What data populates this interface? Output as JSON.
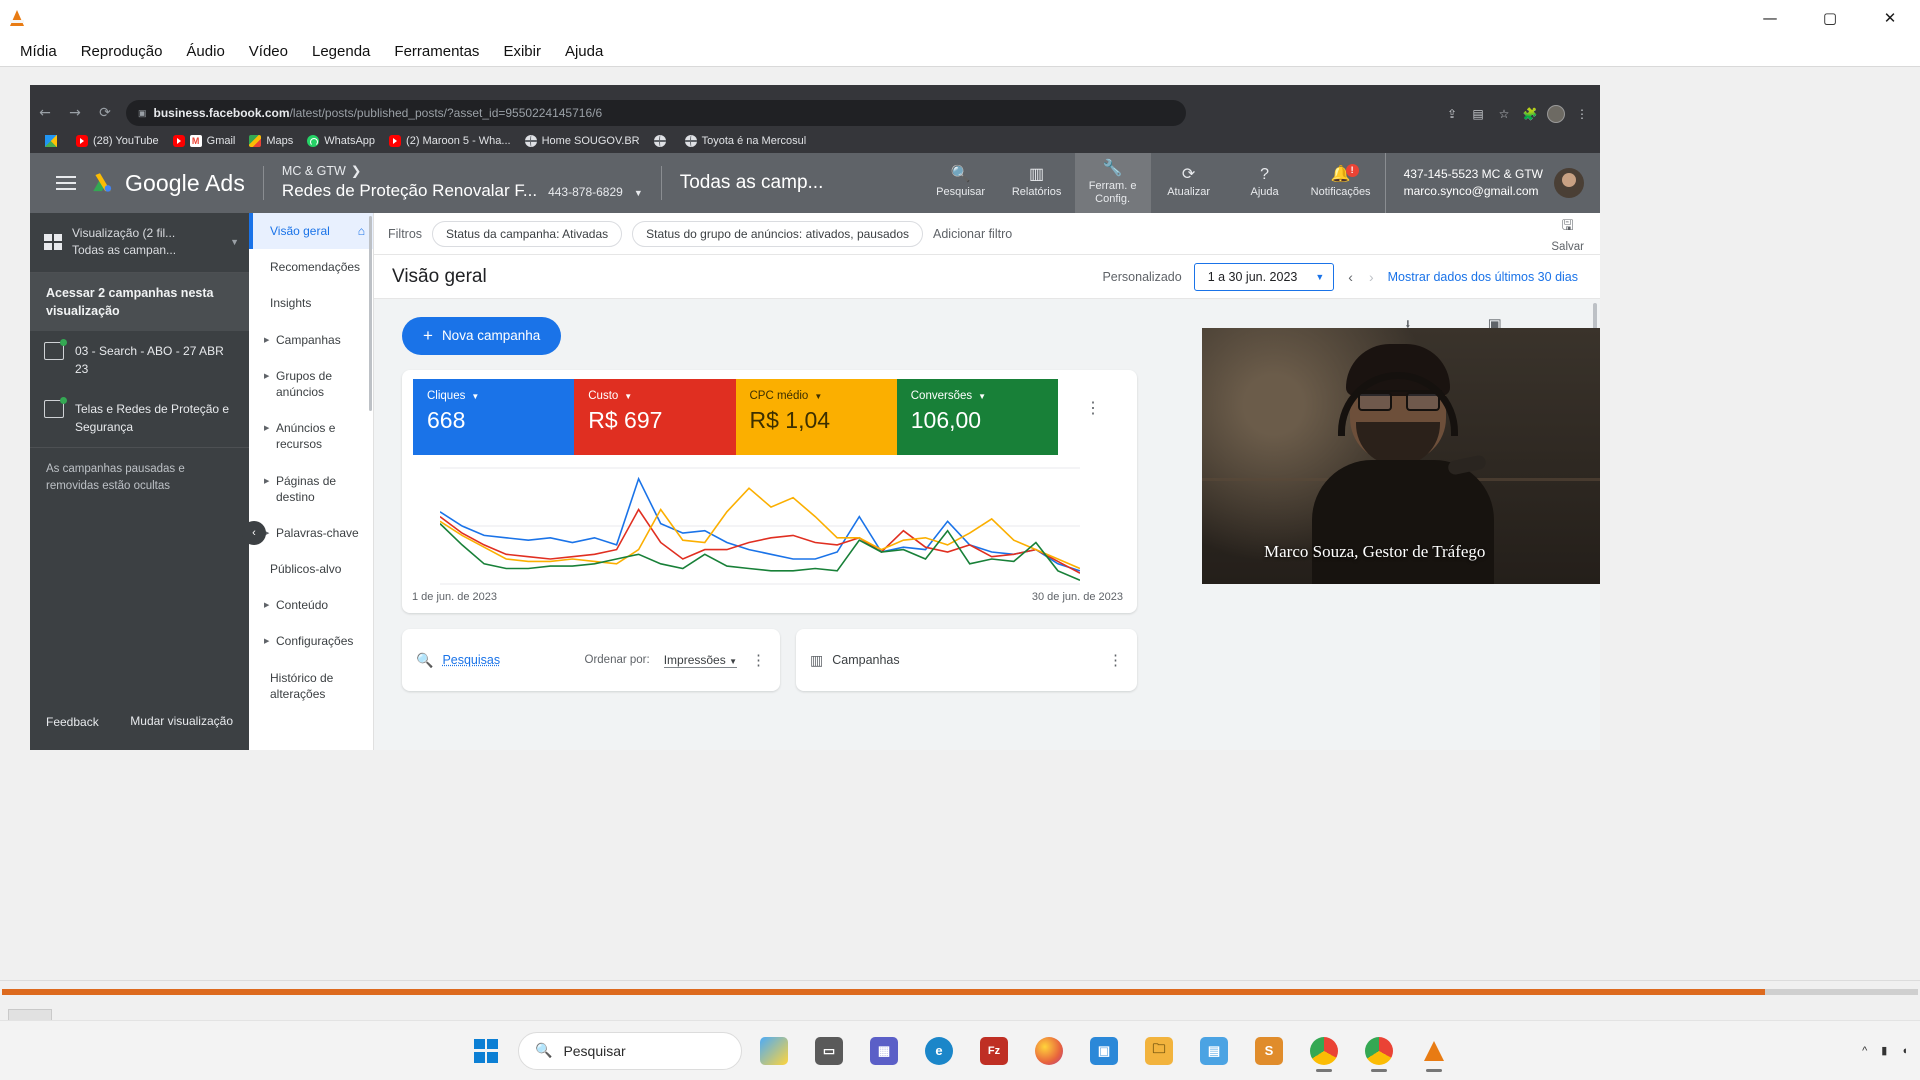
{
  "vlc": {
    "app_icon": "vlc-cone-icon",
    "menu": [
      "Mídia",
      "Reprodução",
      "Áudio",
      "Vídeo",
      "Legenda",
      "Ferramentas",
      "Exibir",
      "Ajuda"
    ],
    "window_controls": {
      "minimize": "—",
      "maximize": "▢",
      "close": "✕"
    },
    "controls": {
      "play": "▶",
      "previous": "⏮",
      "stop": "⏹",
      "next": "⏭",
      "fullscreen": "⛶",
      "equalizer": "equalizer-icon",
      "playlist": "playlist-icon",
      "loop": "🔁",
      "shuffle": "🔀"
    }
  },
  "browser": {
    "back": "←",
    "forward": "→",
    "reload": "⟳",
    "lock_icon": "page-info-icon",
    "url_domain": "business.facebook.com",
    "url_path": "/latest/posts/published_posts/?asset_id=9550224145716/6",
    "bookmarks": [
      {
        "label": "",
        "icon": "drive-icon"
      },
      {
        "label": "(28) YouTube",
        "icon": "youtube-icon"
      },
      {
        "label": "Gmail",
        "icon": "gmail-icon"
      },
      {
        "label": "Maps",
        "icon": "maps-icon"
      },
      {
        "label": "WhatsApp",
        "icon": "whatsapp-icon"
      },
      {
        "label": "(2) Maroon 5 - Wha...",
        "icon": "youtube-icon"
      },
      {
        "label": "Home SOUGOV.BR",
        "icon": "globe-icon"
      },
      {
        "label": "",
        "icon": "globe-icon"
      },
      {
        "label": "Toyota é na Mercosul",
        "icon": "globe-icon"
      }
    ]
  },
  "gads": {
    "logo_text": "Google Ads",
    "account": {
      "parent": "MC & GTW",
      "name": "Redes de Proteção Renovalar F...",
      "id": "443-878-6829"
    },
    "scope": "Todas as camp...",
    "actions": [
      {
        "label": "Pesquisar",
        "icon": "search-icon",
        "glyph": "🔍"
      },
      {
        "label": "Relatórios",
        "icon": "reports-icon",
        "glyph": "▥"
      },
      {
        "label": "Ferram. e Config.",
        "icon": "wrench-icon",
        "glyph": "🔧"
      },
      {
        "label": "Atualizar",
        "icon": "refresh-icon",
        "glyph": "⟳"
      },
      {
        "label": "Ajuda",
        "icon": "help-icon",
        "glyph": "?"
      },
      {
        "label": "Notificações",
        "icon": "bell-icon",
        "glyph": "🔔"
      }
    ],
    "notification_badge": "!",
    "user": {
      "line1": "437-145-5523 MC & GTW",
      "line2": "marco.synco@gmail.com"
    },
    "views_sidebar": {
      "title_line1": "Visualização (2 fil...",
      "title_line2": "Todas as campan...",
      "access": "Acessar 2 campanhas nesta visualização",
      "campaigns": [
        {
          "label": "03 - Search - ABO - 27 ABR 23",
          "icon": "search-campaign-icon"
        },
        {
          "label": "Telas e Redes de Proteção e Segurança",
          "icon": "display-campaign-icon"
        }
      ],
      "note": "As campanhas pausadas e removidas estão ocultas",
      "footer_feedback": "Feedback",
      "footer_change_view": "Mudar visualização"
    },
    "nav": [
      {
        "label": "Visão geral",
        "expandable": false,
        "selected": true,
        "trailing_icon": "home-icon"
      },
      {
        "label": "Recomendações",
        "expandable": false,
        "selected": false
      },
      {
        "label": "Insights",
        "expandable": false,
        "selected": false
      },
      {
        "label": "Campanhas",
        "expandable": true,
        "selected": false
      },
      {
        "label": "Grupos de anúncios",
        "expandable": true,
        "selected": false
      },
      {
        "label": "Anúncios e recursos",
        "expandable": true,
        "selected": false
      },
      {
        "label": "Páginas de destino",
        "expandable": true,
        "selected": false
      },
      {
        "label": "Palavras-chave",
        "expandable": true,
        "selected": false
      },
      {
        "label": "Públicos-alvo",
        "expandable": false,
        "selected": false
      },
      {
        "label": "Conteúdo",
        "expandable": true,
        "selected": false
      },
      {
        "label": "Configurações",
        "expandable": true,
        "selected": false
      },
      {
        "label": "Histórico de alterações",
        "expandable": false,
        "selected": false
      }
    ],
    "collapse_handle": "‹",
    "filters": {
      "label": "Filtros",
      "chips": [
        "Status da campanha: Ativadas",
        "Status do grupo de anúncios: ativados, pausados"
      ],
      "add": "Adicionar filtro",
      "save": "Salvar",
      "save_icon": "save-icon"
    },
    "page_title": "Visão geral",
    "date": {
      "preset_label": "Personalizado",
      "range": "1 a 30 jun. 2023",
      "prev": "‹",
      "next": "›",
      "last30": "Mostrar dados dos últimos 30 dias"
    },
    "new_campaign": "Nova campanha",
    "download": {
      "label": "Download",
      "icon": "download-icon",
      "glyph": "⭳"
    },
    "feedback": {
      "label": "Feedback",
      "icon": "feedback-icon",
      "glyph": "▣"
    },
    "card_menu": "⋮",
    "scorecards": [
      {
        "label": "Cliques",
        "value": "668",
        "color": "#1a73e8",
        "text": "#ffffff"
      },
      {
        "label": "Custo",
        "value": "R$ 697",
        "color": "#e02f21",
        "text": "#ffffff"
      },
      {
        "label": "CPC médio",
        "value": "R$ 1,04",
        "color": "#fbaf00",
        "text": "#3c2f00"
      },
      {
        "label": "Conversões",
        "value": "106,00",
        "color": "#188038",
        "text": "#ffffff"
      }
    ],
    "chart_start_date": "1 de jun. de 2023",
    "chart_end_date": "30 de jun. de 2023",
    "panels": [
      {
        "title": "Pesquisas",
        "icon": "search-icon",
        "sort_label": "Ordenar por:",
        "sort_value": "Impressões",
        "menu": "⋮"
      },
      {
        "title": "Campanhas",
        "icon": "bar-chart-icon",
        "menu": "⋮"
      }
    ]
  },
  "webcam": {
    "caption": "Marco Souza, Gestor de Tráfego"
  },
  "taskbar": {
    "start_icon": "windows-logo-icon",
    "search_placeholder": "Pesquisar",
    "search_icon": "search-icon",
    "apps": [
      {
        "name": "task-view",
        "glyph": "▭",
        "color": "#5a5a5a",
        "open": false
      },
      {
        "name": "teams",
        "glyph": "▦",
        "color": "#5b5fc7",
        "open": false
      },
      {
        "name": "edge",
        "glyph": "e",
        "color": "#1b86c9",
        "open": false
      },
      {
        "name": "filezilla",
        "glyph": "Fz",
        "color": "#bf2f24",
        "open": false
      },
      {
        "name": "firefox",
        "glyph": "◉",
        "color": "#e8643c",
        "open": false
      },
      {
        "name": "microsoft-store",
        "glyph": "▣",
        "color": "#2b88d8",
        "open": false
      },
      {
        "name": "file-explorer",
        "glyph": "🗀",
        "color": "#f2b33d",
        "open": false
      },
      {
        "name": "notepad",
        "glyph": "▤",
        "color": "#4ba3e3",
        "open": false
      },
      {
        "name": "sublime",
        "glyph": "S",
        "color": "#e08c2b",
        "open": false
      },
      {
        "name": "chrome",
        "glyph": "◎",
        "color": "#3b7ddd",
        "open": true
      },
      {
        "name": "chrome-2",
        "glyph": "◎",
        "color": "#3b7ddd",
        "open": true
      },
      {
        "name": "vlc",
        "glyph": "▲",
        "color": "#e87b13",
        "open": true
      }
    ]
  },
  "chart_data": {
    "type": "line",
    "title": "",
    "xlabel": "",
    "ylabel": "",
    "x_start": "1 de jun. de 2023",
    "x_end": "30 de jun. de 2023",
    "grid": false,
    "legend": "none",
    "x": [
      1,
      2,
      3,
      4,
      5,
      6,
      7,
      8,
      9,
      10,
      11,
      12,
      13,
      14,
      15,
      16,
      17,
      18,
      19,
      20,
      21,
      22,
      23,
      24,
      25,
      26,
      27,
      28,
      29,
      30
    ],
    "series": [
      {
        "name": "Cliques",
        "color": "#1a73e8",
        "values": [
          62,
          50,
          42,
          40,
          38,
          40,
          36,
          40,
          34,
          90,
          52,
          44,
          46,
          36,
          30,
          26,
          22,
          22,
          28,
          58,
          28,
          32,
          30,
          54,
          34,
          28,
          26,
          30,
          18,
          12
        ]
      },
      {
        "name": "Custo",
        "color": "#e02f21",
        "values": [
          58,
          44,
          34,
          26,
          24,
          22,
          24,
          26,
          30,
          64,
          36,
          22,
          30,
          30,
          36,
          40,
          42,
          36,
          34,
          40,
          28,
          46,
          32,
          28,
          34,
          24,
          26,
          30,
          20,
          10
        ]
      },
      {
        "name": "CPC médio",
        "color": "#fbaf00",
        "values": [
          54,
          42,
          32,
          22,
          20,
          20,
          22,
          20,
          18,
          30,
          64,
          38,
          36,
          62,
          82,
          66,
          74,
          58,
          40,
          40,
          30,
          38,
          40,
          34,
          44,
          56,
          38,
          30,
          22,
          14
        ]
      },
      {
        "name": "Conversões",
        "color": "#188038",
        "values": [
          52,
          34,
          18,
          14,
          14,
          16,
          16,
          18,
          22,
          26,
          18,
          14,
          26,
          16,
          14,
          12,
          12,
          14,
          12,
          38,
          28,
          30,
          22,
          46,
          18,
          22,
          20,
          36,
          12,
          4
        ]
      }
    ],
    "ylim": [
      0,
      100
    ]
  }
}
